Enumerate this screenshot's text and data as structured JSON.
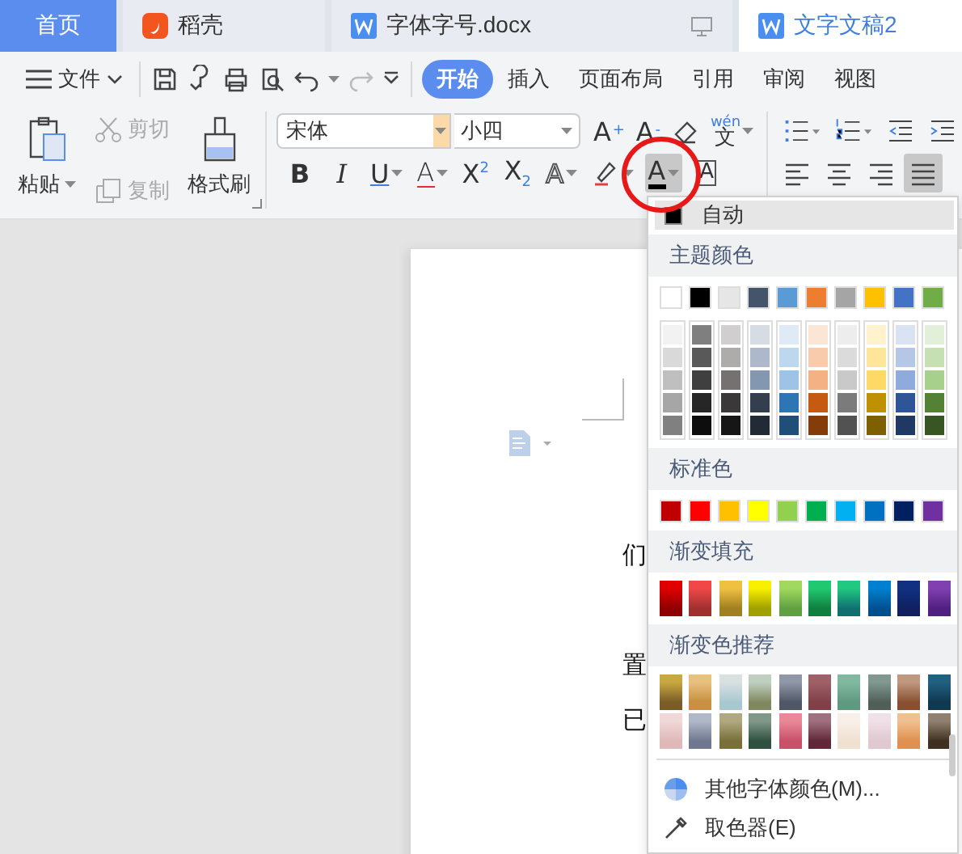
{
  "tabs": [
    {
      "label": "首页",
      "kind": "home",
      "selected": false
    },
    {
      "label": "稻壳",
      "kind": "docer",
      "selected": false
    },
    {
      "label": "字体字号.docx",
      "kind": "document",
      "selected": false
    },
    {
      "label": "文字文稿2",
      "kind": "document",
      "selected": true
    }
  ],
  "menu_bar": {
    "file": "文件",
    "tabs": [
      {
        "label": "开始",
        "selected": true
      },
      {
        "label": "插入",
        "selected": false
      },
      {
        "label": "页面布局",
        "selected": false
      },
      {
        "label": "引用",
        "selected": false
      },
      {
        "label": "审阅",
        "selected": false
      },
      {
        "label": "视图",
        "selected": false
      }
    ]
  },
  "ribbon": {
    "clipboard": {
      "paste": "粘贴",
      "cut": {
        "label": "剪切",
        "disabled": true
      },
      "copy": {
        "label": "复制",
        "disabled": true
      },
      "format_painter": "格式刷"
    },
    "font": {
      "name": "宋体",
      "size": "小四",
      "grow": "A$^{+}$",
      "shrink": "A$^{-}$",
      "phonetic_top": "wén",
      "phonetic_bottom": "文",
      "formats": [
        {
          "kind": "bold",
          "label": "B",
          "dropdown": false,
          "pressed": false
        },
        {
          "kind": "italic",
          "label": "I",
          "dropdown": false,
          "pressed": false
        },
        {
          "kind": "underline",
          "label": "U",
          "dropdown": true,
          "pressed": false
        },
        {
          "kind": "strikethrough",
          "label": "A",
          "dropdown": true,
          "pressed": false
        },
        {
          "kind": "superscript",
          "label": "X$^{2}$",
          "dropdown": false,
          "pressed": false
        },
        {
          "kind": "subscript",
          "label": "X$_{2}$",
          "dropdown": false,
          "pressed": false
        },
        {
          "kind": "outline",
          "label": "A",
          "dropdown": true,
          "pressed": false
        },
        {
          "kind": "highlight",
          "dropdown": true,
          "pressed": false
        },
        {
          "kind": "font_color",
          "label": "A",
          "dropdown": true,
          "pressed": true
        },
        {
          "kind": "char_border",
          "label": "A",
          "dropdown": false,
          "pressed": false
        }
      ]
    },
    "paragraph": {
      "alignments": [
        {
          "kind": "left",
          "selected": false
        },
        {
          "kind": "center",
          "selected": false
        },
        {
          "kind": "right",
          "selected": false
        },
        {
          "kind": "justify",
          "selected": true
        }
      ]
    }
  },
  "document": {
    "text_fragments": [
      "们",
      "置",
      "已"
    ]
  },
  "font_color_menu": {
    "automatic": {
      "label": "自动",
      "color": "#000000"
    },
    "theme_title": "主题颜色",
    "theme_colors": [
      {
        "color": "#ffffff",
        "shades": [
          {
            "color": "#f2f2f2"
          },
          {
            "color": "#d9d9d9"
          },
          {
            "color": "#bfbfbf"
          },
          {
            "color": "#a6a6a6"
          },
          {
            "color": "#808080"
          }
        ]
      },
      {
        "color": "#000000",
        "shades": [
          {
            "color": "#7f7f7f"
          },
          {
            "color": "#595959"
          },
          {
            "color": "#3f3f3f"
          },
          {
            "color": "#262626"
          },
          {
            "color": "#0d0d0d"
          }
        ]
      },
      {
        "color": "#e7e6e6",
        "shades": [
          {
            "color": "#d0cece"
          },
          {
            "color": "#aeabab"
          },
          {
            "color": "#757171"
          },
          {
            "color": "#3a3838"
          },
          {
            "color": "#171616"
          }
        ]
      },
      {
        "color": "#44546a",
        "shades": [
          {
            "color": "#d6dce4"
          },
          {
            "color": "#adb9ca"
          },
          {
            "color": "#8497b0"
          },
          {
            "color": "#333f4f"
          },
          {
            "color": "#222a35"
          }
        ]
      },
      {
        "color": "#5b9bd5",
        "shades": [
          {
            "color": "#deebf6"
          },
          {
            "color": "#bdd7ee"
          },
          {
            "color": "#9dc3e6"
          },
          {
            "color": "#2e75b5"
          },
          {
            "color": "#1f4e79"
          }
        ]
      },
      {
        "color": "#ed7d31",
        "shades": [
          {
            "color": "#fbe5d5"
          },
          {
            "color": "#f8cbad"
          },
          {
            "color": "#f4b183"
          },
          {
            "color": "#c55a11"
          },
          {
            "color": "#843c0b"
          }
        ]
      },
      {
        "color": "#a5a5a5",
        "shades": [
          {
            "color": "#ededed"
          },
          {
            "color": "#dbdbdb"
          },
          {
            "color": "#c9c9c9"
          },
          {
            "color": "#7b7b7b"
          },
          {
            "color": "#525252"
          }
        ]
      },
      {
        "color": "#ffc000",
        "shades": [
          {
            "color": "#fff2cc"
          },
          {
            "color": "#fee599"
          },
          {
            "color": "#ffd966"
          },
          {
            "color": "#bf9000"
          },
          {
            "color": "#7f6000"
          }
        ]
      },
      {
        "color": "#4472c4",
        "shades": [
          {
            "color": "#dae3f3"
          },
          {
            "color": "#b4c7e7"
          },
          {
            "color": "#8faadc"
          },
          {
            "color": "#2f5597"
          },
          {
            "color": "#1f3864"
          }
        ]
      },
      {
        "color": "#70ad47",
        "shades": [
          {
            "color": "#e2efd9"
          },
          {
            "color": "#c5e0b3"
          },
          {
            "color": "#a8d08d"
          },
          {
            "color": "#538135"
          },
          {
            "color": "#375623"
          }
        ]
      }
    ],
    "standard_title": "标准色",
    "standard_colors": [
      {
        "color": "#c00000"
      },
      {
        "color": "#ff0000"
      },
      {
        "color": "#ffc000"
      },
      {
        "color": "#ffff00"
      },
      {
        "color": "#92d050"
      },
      {
        "color": "#00b050"
      },
      {
        "color": "#00b0f0"
      },
      {
        "color": "#0070c0"
      },
      {
        "color": "#002060"
      },
      {
        "color": "#7030a0"
      }
    ],
    "gradient_title": "渐变填充",
    "gradients": [
      {
        "stops": [
          {
            "color": "#e00000"
          },
          {
            "color": "#900000"
          }
        ]
      },
      {
        "stops": [
          {
            "color": "#f04848"
          },
          {
            "color": "#a03030"
          }
        ]
      },
      {
        "stops": [
          {
            "color": "#f0c040"
          },
          {
            "color": "#a08020"
          }
        ]
      },
      {
        "stops": [
          {
            "color": "#f8f000"
          },
          {
            "color": "#a0a000"
          }
        ]
      },
      {
        "stops": [
          {
            "color": "#a0d860"
          },
          {
            "color": "#60a040"
          }
        ]
      },
      {
        "stops": [
          {
            "color": "#20c870"
          },
          {
            "color": "#108040"
          }
        ]
      },
      {
        "stops": [
          {
            "color": "#20c880"
          },
          {
            "color": "#107070"
          }
        ]
      },
      {
        "stops": [
          {
            "color": "#0080d0"
          },
          {
            "color": "#005090"
          }
        ]
      },
      {
        "stops": [
          {
            "color": "#103080"
          },
          {
            "color": "#102060"
          }
        ]
      },
      {
        "stops": [
          {
            "color": "#8040b0"
          },
          {
            "color": "#502080"
          }
        ]
      }
    ],
    "recommended_title": "渐变色推荐",
    "recommended_rows": [
      [
        {
          "stops": [
            {
              "color": "#c8a840"
            },
            {
              "color": "#7a5c28"
            }
          ]
        },
        {
          "stops": [
            {
              "color": "#e8c080"
            },
            {
              "color": "#c89040"
            }
          ]
        },
        {
          "stops": [
            {
              "color": "#d8e0e0"
            },
            {
              "color": "#a8c8d0"
            }
          ]
        },
        {
          "stops": [
            {
              "color": "#c0d0c0"
            },
            {
              "color": "#808860"
            }
          ]
        },
        {
          "stops": [
            {
              "color": "#9098a8"
            },
            {
              "color": "#505868"
            }
          ]
        },
        {
          "stops": [
            {
              "color": "#a06068"
            },
            {
              "color": "#804048"
            }
          ]
        },
        {
          "stops": [
            {
              "color": "#80b8a0"
            },
            {
              "color": "#609880"
            }
          ]
        },
        {
          "stops": [
            {
              "color": "#809890"
            },
            {
              "color": "#506058"
            }
          ]
        },
        {
          "stops": [
            {
              "color": "#c09880"
            },
            {
              "color": "#885030"
            }
          ]
        },
        {
          "stops": [
            {
              "color": "#206080"
            },
            {
              "color": "#103850"
            }
          ]
        }
      ],
      [
        {
          "stops": [
            {
              "color": "#f0d8d8"
            },
            {
              "color": "#e0b8b8"
            }
          ]
        },
        {
          "stops": [
            {
              "color": "#b0b8c8"
            },
            {
              "color": "#707890"
            }
          ]
        },
        {
          "stops": [
            {
              "color": "#b0a880"
            },
            {
              "color": "#787038"
            }
          ]
        },
        {
          "stops": [
            {
              "color": "#809888"
            },
            {
              "color": "#305040"
            }
          ]
        },
        {
          "stops": [
            {
              "color": "#e88898"
            },
            {
              "color": "#c85068"
            }
          ]
        },
        {
          "stops": [
            {
              "color": "#a07080"
            },
            {
              "color": "#602838"
            }
          ]
        },
        {
          "stops": [
            {
              "color": "#f8f0e8"
            },
            {
              "color": "#f0e0d0"
            }
          ]
        },
        {
          "stops": [
            {
              "color": "#f0e0e8"
            },
            {
              "color": "#e0c8d0"
            }
          ]
        },
        {
          "stops": [
            {
              "color": "#f0c090"
            },
            {
              "color": "#e09050"
            }
          ]
        },
        {
          "stops": [
            {
              "color": "#908070"
            },
            {
              "color": "#403020"
            }
          ]
        }
      ]
    ],
    "more_colors": "其他字体颜色(M)...",
    "eyedropper": "取色器(E)"
  }
}
